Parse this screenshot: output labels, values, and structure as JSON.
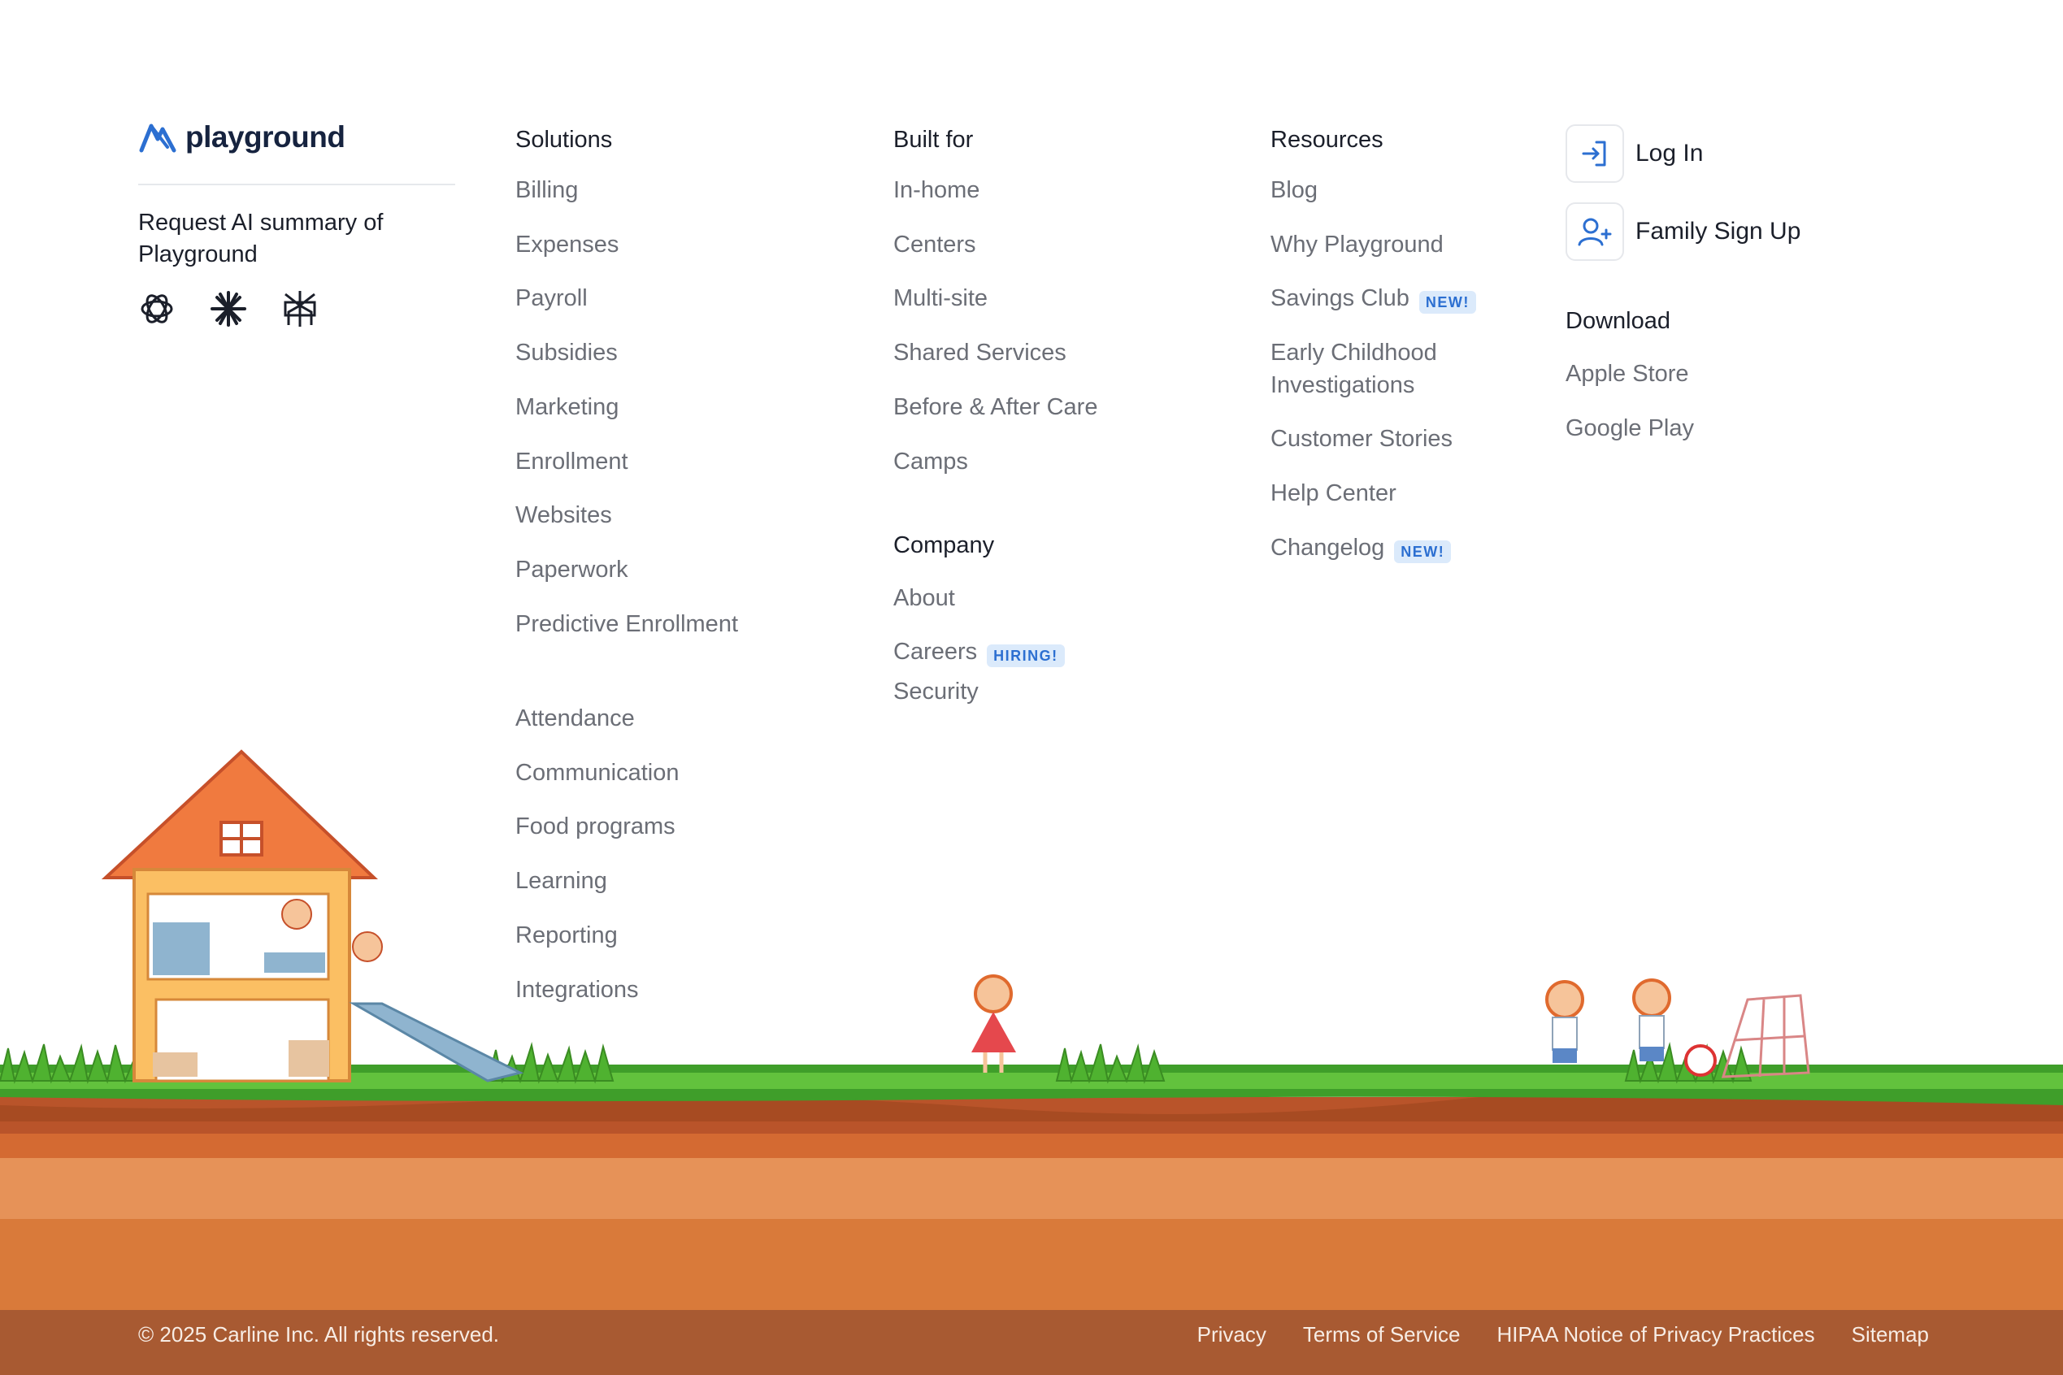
{
  "brand": {
    "name": "playground"
  },
  "ai_summary": {
    "text": "Request AI summary of Playground",
    "icons": [
      "openai-icon",
      "claude-icon",
      "perplexity-icon"
    ]
  },
  "solutions": {
    "heading": "Solutions",
    "items": [
      "Billing",
      "Expenses",
      "Payroll",
      "Subsidies",
      "Marketing",
      "Enrollment",
      "Websites",
      "Paperwork",
      "Predictive Enrollment",
      "Attendance",
      "Communication",
      "Food programs",
      "Learning",
      "Reporting",
      "Integrations"
    ]
  },
  "built_for": {
    "heading": "Built for",
    "items": [
      "In-home",
      "Centers",
      "Multi-site",
      "Shared Services",
      "Before & After Care",
      "Camps"
    ]
  },
  "company": {
    "heading": "Company",
    "about": "About",
    "careers": "Careers",
    "careers_badge": "HIRING!",
    "security": "Security"
  },
  "resources": {
    "heading": "Resources",
    "blog": "Blog",
    "why": "Why Playground",
    "savings": "Savings Club",
    "savings_badge": "NEW!",
    "ece_line1": "Early Childhood",
    "ece_line2": "Investigations",
    "stories": "Customer Stories",
    "help": "Help Center",
    "changelog": "Changelog",
    "changelog_badge": "NEW!"
  },
  "auth": {
    "login": "Log In",
    "signup": "Family Sign Up"
  },
  "download": {
    "heading": "Download",
    "apple": "Apple Store",
    "google": "Google Play"
  },
  "footer": {
    "copyright": "© 2025 Carline Inc. All rights reserved.",
    "links": [
      "Privacy",
      "Terms of Service",
      "HIPAA Notice of Privacy Practices",
      "Sitemap"
    ]
  },
  "colors": {
    "brand_blue": "#2c6fd1",
    "footer_bg": "#a85a32",
    "grass": "#4caf2e",
    "soil": "#d97a3a"
  }
}
